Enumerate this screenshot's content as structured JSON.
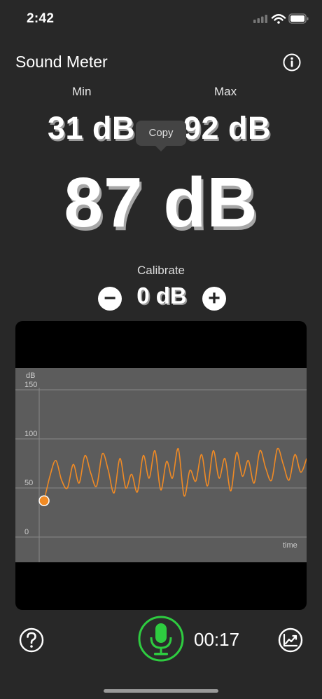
{
  "status": {
    "time": "2:42"
  },
  "header": {
    "title": "Sound Meter"
  },
  "meter": {
    "min_label": "Min",
    "max_label": "Max",
    "min_value": "31 dB",
    "max_value": "92 dB",
    "current_value": "87 dB",
    "copy_label": "Copy"
  },
  "calibrate": {
    "label": "Calibrate",
    "value": "0 dB",
    "minus": "−",
    "plus": "+"
  },
  "chart_data": {
    "type": "line",
    "ylabel": "dB",
    "xlabel": "time",
    "yticks": [
      "150",
      "100",
      "50",
      "0"
    ],
    "ylim": [
      0,
      150
    ],
    "grid": true,
    "series": [
      {
        "color": "#f08a24",
        "values": [
          37,
          62,
          78,
          58,
          50,
          74,
          55,
          83,
          65,
          52,
          85,
          68,
          45,
          80,
          50,
          64,
          46,
          83,
          60,
          88,
          48,
          77,
          60,
          90,
          42,
          68,
          57,
          84,
          52,
          88,
          60,
          80,
          47,
          86,
          62,
          78,
          55,
          88,
          70,
          58,
          90,
          74,
          58,
          84,
          66,
          80
        ]
      }
    ],
    "marker_value": 37
  },
  "footer": {
    "timer": "00:17"
  },
  "icons": {
    "info": "info-circle-icon",
    "help": "question-circle-icon",
    "mic": "microphone-icon",
    "stats": "chart-trend-icon"
  },
  "colors": {
    "accent": "#f08a24",
    "mic": "#2ecc40",
    "background": "#282828"
  }
}
